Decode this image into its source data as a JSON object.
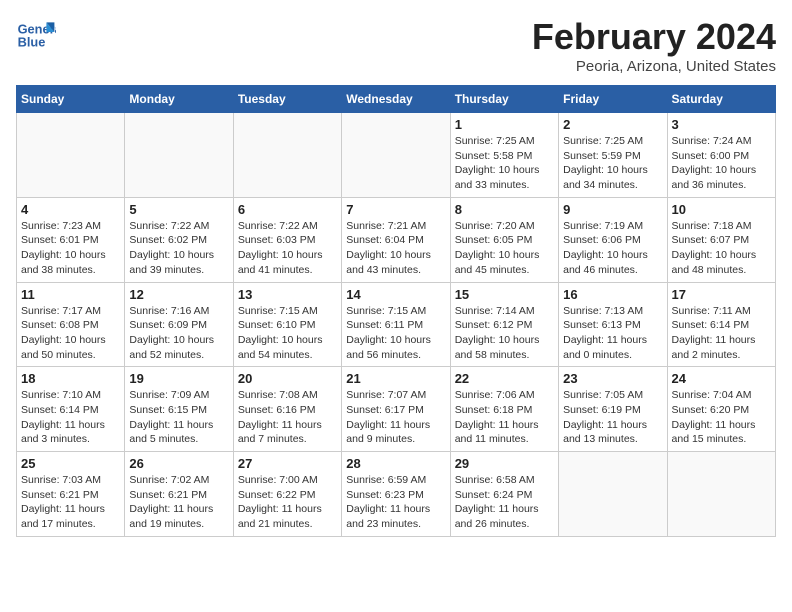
{
  "header": {
    "logo_line1": "General",
    "logo_line2": "Blue",
    "month_title": "February 2024",
    "location": "Peoria, Arizona, United States"
  },
  "days_of_week": [
    "Sunday",
    "Monday",
    "Tuesday",
    "Wednesday",
    "Thursday",
    "Friday",
    "Saturday"
  ],
  "weeks": [
    [
      {
        "day": "",
        "info": ""
      },
      {
        "day": "",
        "info": ""
      },
      {
        "day": "",
        "info": ""
      },
      {
        "day": "",
        "info": ""
      },
      {
        "day": "1",
        "info": "Sunrise: 7:25 AM\nSunset: 5:58 PM\nDaylight: 10 hours\nand 33 minutes."
      },
      {
        "day": "2",
        "info": "Sunrise: 7:25 AM\nSunset: 5:59 PM\nDaylight: 10 hours\nand 34 minutes."
      },
      {
        "day": "3",
        "info": "Sunrise: 7:24 AM\nSunset: 6:00 PM\nDaylight: 10 hours\nand 36 minutes."
      }
    ],
    [
      {
        "day": "4",
        "info": "Sunrise: 7:23 AM\nSunset: 6:01 PM\nDaylight: 10 hours\nand 38 minutes."
      },
      {
        "day": "5",
        "info": "Sunrise: 7:22 AM\nSunset: 6:02 PM\nDaylight: 10 hours\nand 39 minutes."
      },
      {
        "day": "6",
        "info": "Sunrise: 7:22 AM\nSunset: 6:03 PM\nDaylight: 10 hours\nand 41 minutes."
      },
      {
        "day": "7",
        "info": "Sunrise: 7:21 AM\nSunset: 6:04 PM\nDaylight: 10 hours\nand 43 minutes."
      },
      {
        "day": "8",
        "info": "Sunrise: 7:20 AM\nSunset: 6:05 PM\nDaylight: 10 hours\nand 45 minutes."
      },
      {
        "day": "9",
        "info": "Sunrise: 7:19 AM\nSunset: 6:06 PM\nDaylight: 10 hours\nand 46 minutes."
      },
      {
        "day": "10",
        "info": "Sunrise: 7:18 AM\nSunset: 6:07 PM\nDaylight: 10 hours\nand 48 minutes."
      }
    ],
    [
      {
        "day": "11",
        "info": "Sunrise: 7:17 AM\nSunset: 6:08 PM\nDaylight: 10 hours\nand 50 minutes."
      },
      {
        "day": "12",
        "info": "Sunrise: 7:16 AM\nSunset: 6:09 PM\nDaylight: 10 hours\nand 52 minutes."
      },
      {
        "day": "13",
        "info": "Sunrise: 7:15 AM\nSunset: 6:10 PM\nDaylight: 10 hours\nand 54 minutes."
      },
      {
        "day": "14",
        "info": "Sunrise: 7:15 AM\nSunset: 6:11 PM\nDaylight: 10 hours\nand 56 minutes."
      },
      {
        "day": "15",
        "info": "Sunrise: 7:14 AM\nSunset: 6:12 PM\nDaylight: 10 hours\nand 58 minutes."
      },
      {
        "day": "16",
        "info": "Sunrise: 7:13 AM\nSunset: 6:13 PM\nDaylight: 11 hours\nand 0 minutes."
      },
      {
        "day": "17",
        "info": "Sunrise: 7:11 AM\nSunset: 6:14 PM\nDaylight: 11 hours\nand 2 minutes."
      }
    ],
    [
      {
        "day": "18",
        "info": "Sunrise: 7:10 AM\nSunset: 6:14 PM\nDaylight: 11 hours\nand 3 minutes."
      },
      {
        "day": "19",
        "info": "Sunrise: 7:09 AM\nSunset: 6:15 PM\nDaylight: 11 hours\nand 5 minutes."
      },
      {
        "day": "20",
        "info": "Sunrise: 7:08 AM\nSunset: 6:16 PM\nDaylight: 11 hours\nand 7 minutes."
      },
      {
        "day": "21",
        "info": "Sunrise: 7:07 AM\nSunset: 6:17 PM\nDaylight: 11 hours\nand 9 minutes."
      },
      {
        "day": "22",
        "info": "Sunrise: 7:06 AM\nSunset: 6:18 PM\nDaylight: 11 hours\nand 11 minutes."
      },
      {
        "day": "23",
        "info": "Sunrise: 7:05 AM\nSunset: 6:19 PM\nDaylight: 11 hours\nand 13 minutes."
      },
      {
        "day": "24",
        "info": "Sunrise: 7:04 AM\nSunset: 6:20 PM\nDaylight: 11 hours\nand 15 minutes."
      }
    ],
    [
      {
        "day": "25",
        "info": "Sunrise: 7:03 AM\nSunset: 6:21 PM\nDaylight: 11 hours\nand 17 minutes."
      },
      {
        "day": "26",
        "info": "Sunrise: 7:02 AM\nSunset: 6:21 PM\nDaylight: 11 hours\nand 19 minutes."
      },
      {
        "day": "27",
        "info": "Sunrise: 7:00 AM\nSunset: 6:22 PM\nDaylight: 11 hours\nand 21 minutes."
      },
      {
        "day": "28",
        "info": "Sunrise: 6:59 AM\nSunset: 6:23 PM\nDaylight: 11 hours\nand 23 minutes."
      },
      {
        "day": "29",
        "info": "Sunrise: 6:58 AM\nSunset: 6:24 PM\nDaylight: 11 hours\nand 26 minutes."
      },
      {
        "day": "",
        "info": ""
      },
      {
        "day": "",
        "info": ""
      }
    ]
  ]
}
